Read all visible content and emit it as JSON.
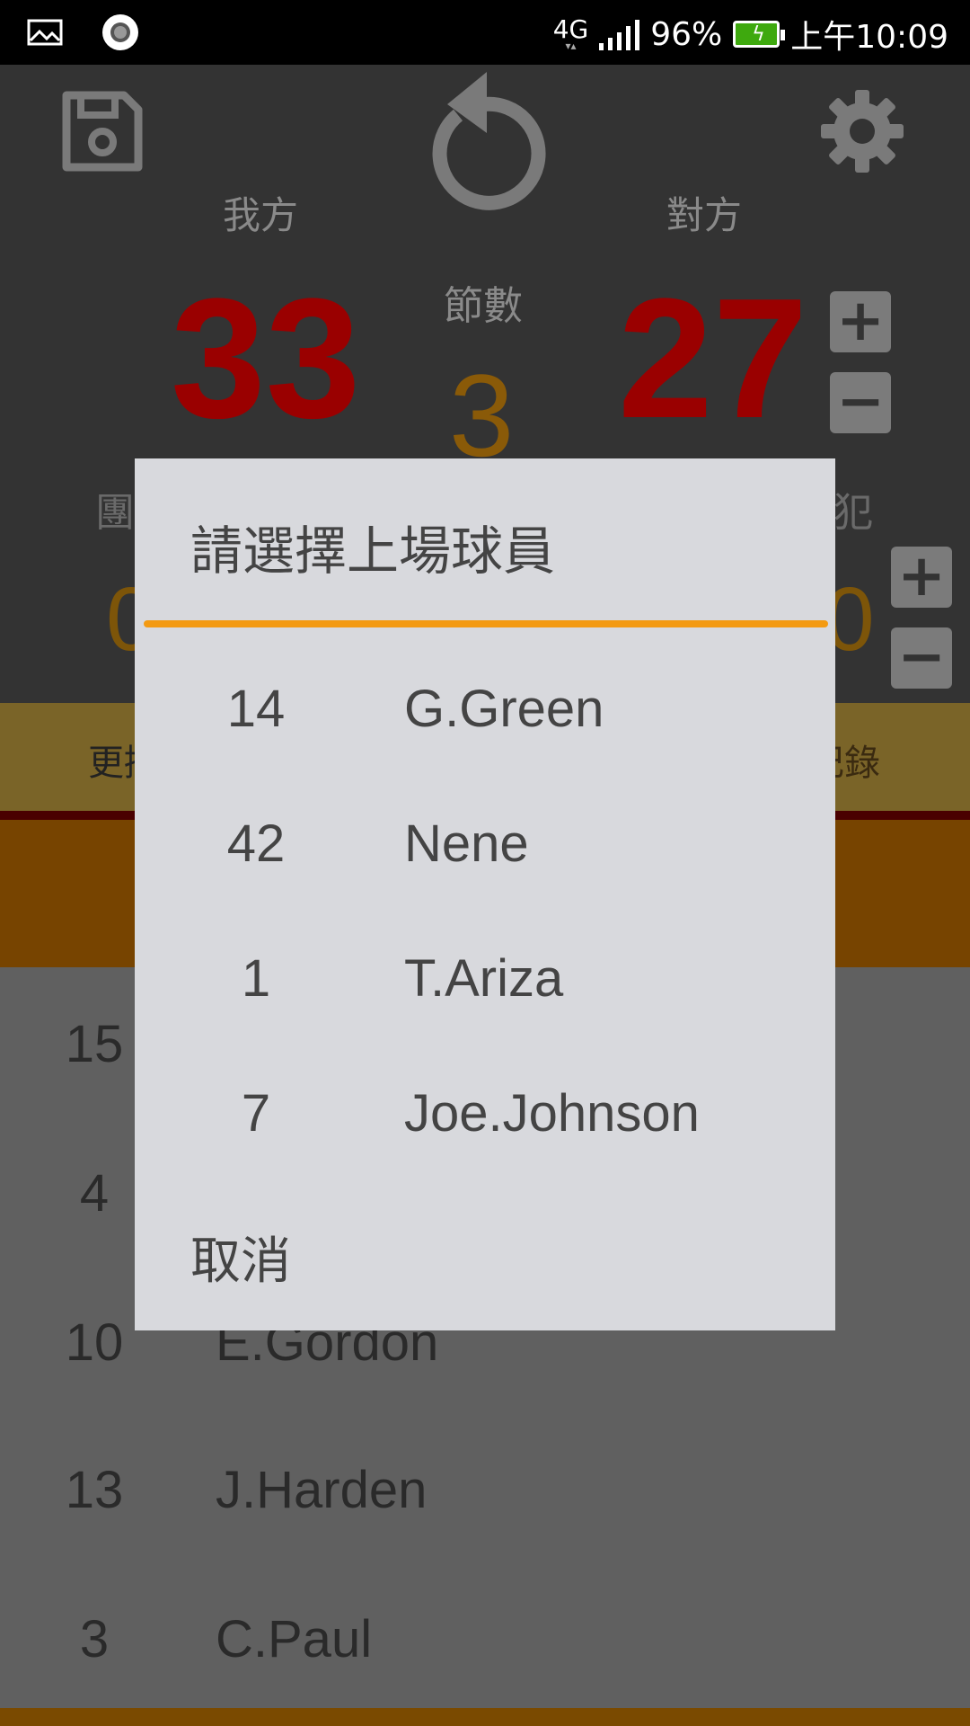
{
  "status_bar": {
    "network": "4G",
    "battery": "96%",
    "time": "上午10:09",
    "colors": {
      "battery_fill": "#3ea90e"
    }
  },
  "scoreboard": {
    "home_label": "我方",
    "away_label": "對方",
    "period_label": "節數",
    "home_score": "33",
    "away_score": "27",
    "period": "3",
    "left_partial_label": "團",
    "right_partial_label": "犯",
    "left_partial_value": "0",
    "right_partial_value": "0",
    "icons": [
      "save-icon",
      "undo-icon",
      "settings-icon",
      "plus-icon",
      "minus-icon"
    ]
  },
  "button_bar": {
    "left_label_partial": "更換",
    "right_label_partial": "記錄"
  },
  "roster": [
    {
      "number": "15",
      "name": ""
    },
    {
      "number": "4",
      "name": ""
    },
    {
      "number": "10",
      "name": "E.Gordon"
    },
    {
      "number": "13",
      "name": "J.Harden"
    },
    {
      "number": "3",
      "name": "C.Paul"
    }
  ],
  "dialog": {
    "title": "請選擇上場球員",
    "options": [
      {
        "number": "14",
        "name": "G.Green"
      },
      {
        "number": "42",
        "name": "Nene"
      },
      {
        "number": "1",
        "name": "T.Ariza"
      },
      {
        "number": "7",
        "name": "Joe.Johnson"
      }
    ],
    "cancel": "取消",
    "colors": {
      "divider": "#f39a12",
      "background": "#d8d9dd"
    }
  },
  "colors": {
    "score": "#9a0000",
    "period": "#8a5a08"
  }
}
